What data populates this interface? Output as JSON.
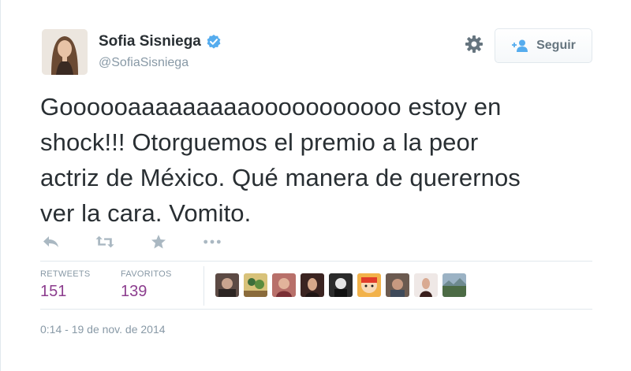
{
  "user": {
    "full_name": "Sofia Sisniega",
    "handle": "@SofiaSisniega",
    "verified": true
  },
  "follow_button": {
    "label": "Seguir"
  },
  "tweet": {
    "lines": [
      "Goooooaaaaaaaaaooooooooooo estoy en",
      "shock!!! Otorguemos el premio a la peor",
      "actriz de México. Qué manera de querernos",
      "ver la cara. Vomito."
    ]
  },
  "actions": [
    "reply-icon",
    "retweet-icon",
    "favorite-icon",
    "more-icon"
  ],
  "stats": {
    "retweets_label": "RETWEETS",
    "retweets_count": "151",
    "favorites_label": "FAVORITOS",
    "favorites_count": "139"
  },
  "timestamp": "0:14 - 19 de nov. de 2014",
  "colors": {
    "stat_value": "#8c3d8e",
    "muted": "#8899a6",
    "text": "#292f33",
    "verified": "#55acee"
  }
}
